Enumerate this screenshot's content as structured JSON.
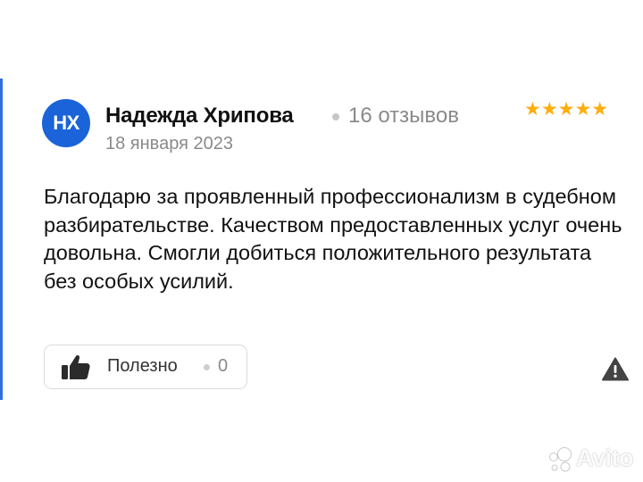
{
  "review": {
    "author": {
      "initials": "НХ",
      "name": "Надежда Хрипова",
      "reviews_count": "16 отзывов",
      "avatar_color": "#1a63d8"
    },
    "date": "18 января 2023",
    "rating": 5,
    "stars_display": "★★★★★",
    "star_color": "#ffad0d",
    "text": "Благодарю за проявленный профессионализм в судебном разбирательстве. Качеством предоставленных услуг очень довольна. Смогли добиться положительного результата без особых усилий."
  },
  "actions": {
    "helpful_label": "Полезно",
    "helpful_count": "0",
    "thumb_icon": "thumb-up-icon",
    "report_icon": "warning-triangle-icon"
  },
  "watermark": {
    "text": "Avito"
  }
}
